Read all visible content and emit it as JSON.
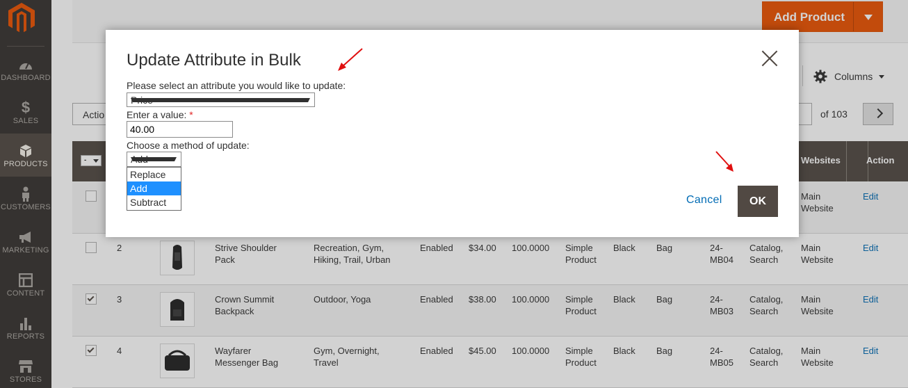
{
  "sidebar": {
    "items": [
      {
        "label": "DASHBOARD",
        "icon": "dashboard-icon"
      },
      {
        "label": "SALES",
        "icon": "dollar-icon"
      },
      {
        "label": "PRODUCTS",
        "icon": "cube-icon"
      },
      {
        "label": "CUSTOMERS",
        "icon": "person-icon"
      },
      {
        "label": "MARKETING",
        "icon": "megaphone-icon"
      },
      {
        "label": "CONTENT",
        "icon": "layout-icon"
      },
      {
        "label": "REPORTS",
        "icon": "bar-chart-icon"
      },
      {
        "label": "STORES",
        "icon": "storefront-icon"
      }
    ],
    "active": "PRODUCTS"
  },
  "header": {
    "add_product_label": "Add Product"
  },
  "toolbar": {
    "columns_label": "Columns",
    "actions_label": "Actio",
    "of_pages": "of 103"
  },
  "grid": {
    "headers": {
      "websites": "Websites",
      "action": "Action"
    },
    "rows": [
      {
        "checked": false,
        "id": "",
        "name": "",
        "categories": "",
        "status": "",
        "price": "",
        "qty": "",
        "type": "",
        "color": "",
        "attr_set": "",
        "sku": "",
        "visibility": "",
        "websites": "Main Website",
        "action": "Edit"
      },
      {
        "checked": false,
        "id": "2",
        "name": "Strive Shoulder Pack",
        "categories": "Recreation, Gym, Hiking, Trail, Urban",
        "status": "Enabled",
        "price": "$34.00",
        "qty": "100.0000",
        "type": "Simple Product",
        "color": "Black",
        "attr_set": "Bag",
        "sku": "24-MB04",
        "visibility": "Catalog, Search",
        "websites": "Main Website",
        "action": "Edit"
      },
      {
        "checked": true,
        "id": "3",
        "name": "Crown Summit Backpack",
        "categories": "Outdoor, Yoga",
        "status": "Enabled",
        "price": "$38.00",
        "qty": "100.0000",
        "type": "Simple Product",
        "color": "Black",
        "attr_set": "Bag",
        "sku": "24-MB03",
        "visibility": "Catalog, Search",
        "websites": "Main Website",
        "action": "Edit"
      },
      {
        "checked": true,
        "id": "4",
        "name": "Wayfarer Messenger Bag",
        "categories": "Gym, Overnight, Travel",
        "status": "Enabled",
        "price": "$45.00",
        "qty": "100.0000",
        "type": "Simple Product",
        "color": "Black",
        "attr_set": "Bag",
        "sku": "24-MB05",
        "visibility": "Catalog, Search",
        "websites": "Main Website",
        "action": "Edit"
      }
    ]
  },
  "modal": {
    "title": "Update Attribute in Bulk",
    "attr_label": "Please select an attribute you would like to update:",
    "attr_value": "Price",
    "value_label": "Enter a value:",
    "required_mark": "*",
    "value": "40.00",
    "method_label": "Choose a method of update:",
    "method_value": "Add",
    "method_options": [
      "Replace",
      "Add",
      "Subtract"
    ],
    "cancel_label": "Cancel",
    "ok_label": "OK"
  },
  "colors": {
    "accent": "#eb5202",
    "sidebar": "#373330",
    "header": "#514943",
    "link": "#006bb4",
    "annotation": "#e01010"
  }
}
